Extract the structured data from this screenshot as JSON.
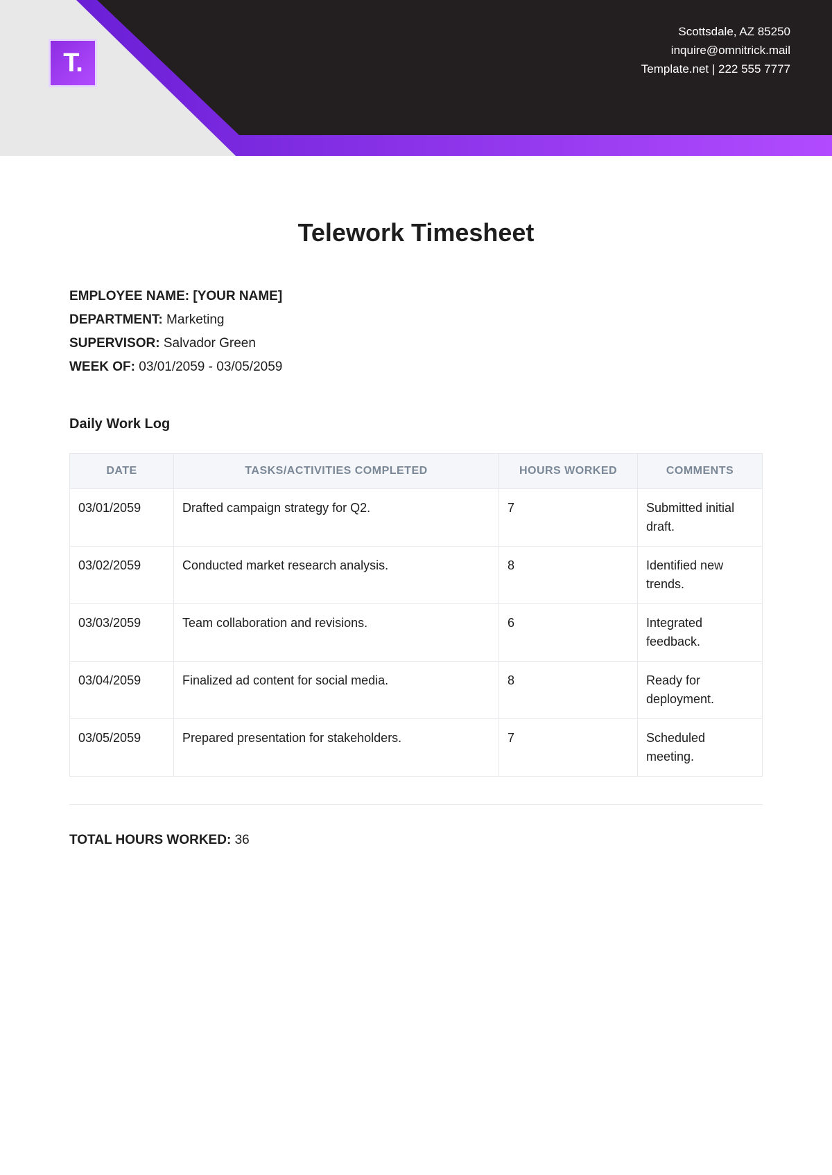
{
  "header": {
    "logo_letter": "T.",
    "address": "Scottsdale, AZ 85250",
    "email": "inquire@omnitrick.mail",
    "site_phone": "Template.net | 222 555 7777"
  },
  "doc": {
    "title": "Telework Timesheet",
    "employee_label": "EMPLOYEE NAME:",
    "employee_value": "[YOUR NAME]",
    "department_label": "DEPARTMENT:",
    "department_value": "Marketing",
    "supervisor_label": "SUPERVISOR:",
    "supervisor_value": "Salvador Green",
    "week_label": "WEEK OF:",
    "week_value": "03/01/2059 - 03/05/2059",
    "section_title": "Daily Work Log",
    "total_label": "TOTAL HOURS WORKED:",
    "total_value": "36"
  },
  "table": {
    "headers": {
      "date": "DATE",
      "tasks": "TASKS/ACTIVITIES COMPLETED",
      "hours": "HOURS WORKED",
      "comments": "COMMENTS"
    },
    "rows": [
      {
        "date": "03/01/2059",
        "tasks": "Drafted campaign strategy for Q2.",
        "hours": "7",
        "comments": "Submitted initial draft."
      },
      {
        "date": "03/02/2059",
        "tasks": "Conducted market research analysis.",
        "hours": "8",
        "comments": "Identified new trends."
      },
      {
        "date": "03/03/2059",
        "tasks": "Team collaboration and revisions.",
        "hours": "6",
        "comments": "Integrated feedback."
      },
      {
        "date": "03/04/2059",
        "tasks": "Finalized ad content for social media.",
        "hours": "8",
        "comments": "Ready for deployment."
      },
      {
        "date": "03/05/2059",
        "tasks": "Prepared presentation for stakeholders.",
        "hours": "7",
        "comments": "Scheduled meeting."
      }
    ]
  }
}
